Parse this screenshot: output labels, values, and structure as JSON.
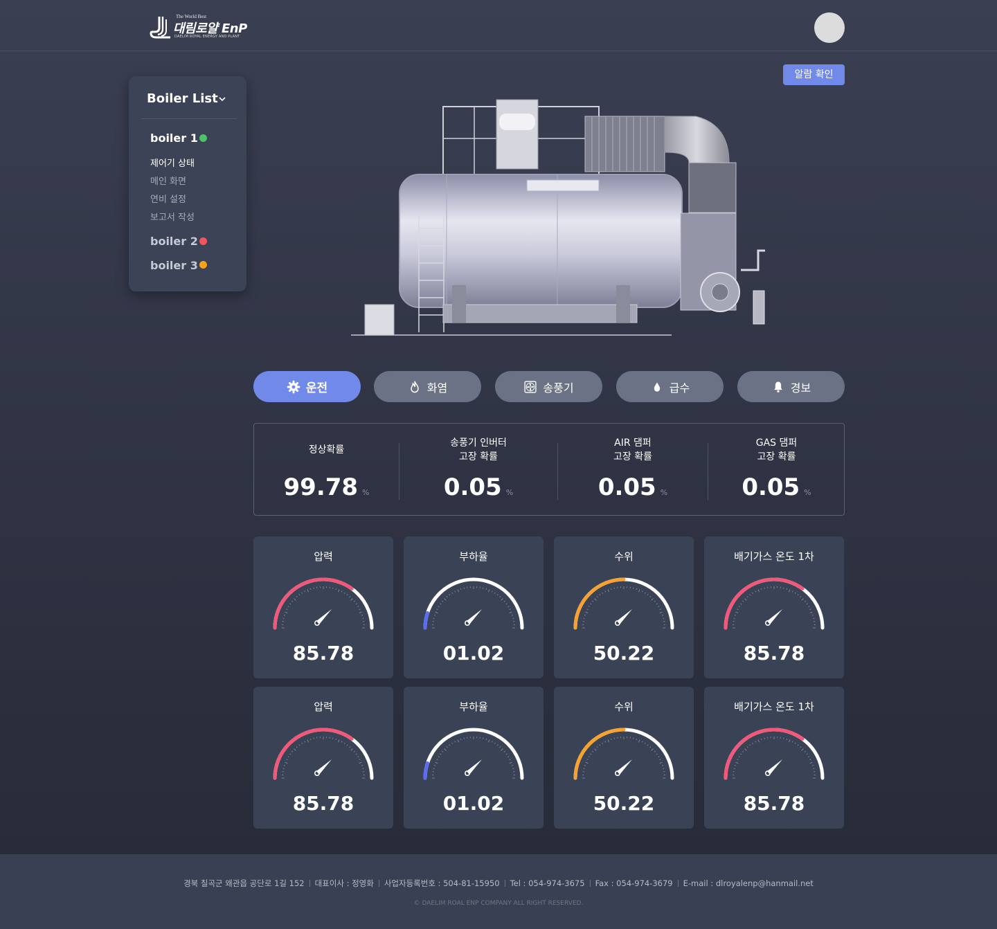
{
  "header": {
    "logo_top": "The World Best",
    "logo_main": "대림로얄 EnP",
    "logo_sub": "DAELIM ROYAL ENERGY AND PLANT"
  },
  "alarm_button": "알람 확인",
  "sidebar": {
    "title": "Boiler List",
    "boilers": [
      {
        "label": "boiler 1",
        "status_color": "#4fc265",
        "submenu": [
          "제어기 상태",
          "메인 화면",
          "연비 설정",
          "보고서 작성"
        ]
      },
      {
        "label": "boiler 2",
        "status_color": "#f05561"
      },
      {
        "label": "boiler 3",
        "status_color": "#f7a21c"
      }
    ]
  },
  "tabs": [
    {
      "label": "운전",
      "icon": "gear-icon",
      "active": true
    },
    {
      "label": "화염",
      "icon": "flame-icon",
      "active": false
    },
    {
      "label": "송풍기",
      "icon": "fan-icon",
      "active": false
    },
    {
      "label": "급수",
      "icon": "water-drop-icon",
      "active": false
    },
    {
      "label": "경보",
      "icon": "bell-icon",
      "active": false
    }
  ],
  "probabilities": [
    {
      "label_line1": "정상확률",
      "label_line2": "",
      "value": "99.78",
      "unit": "%"
    },
    {
      "label_line1": "송풍기 인버터",
      "label_line2": "고장 확률",
      "value": "0.05",
      "unit": "%"
    },
    {
      "label_line1": "AIR 댐퍼",
      "label_line2": "고장 확률",
      "value": "0.05",
      "unit": "%"
    },
    {
      "label_line1": "GAS 댐퍼",
      "label_line2": "고장 확률",
      "value": "0.05",
      "unit": "%"
    }
  ],
  "gauges": [
    {
      "title": "압력",
      "value": "85.78",
      "fill": 0.7,
      "color": "#f2587a"
    },
    {
      "title": "부하율",
      "value": "01.02",
      "fill": 0.1,
      "color": "#5a6cf0"
    },
    {
      "title": "수위",
      "value": "50.22",
      "fill": 0.5,
      "color": "#f7a230"
    },
    {
      "title": "배기가스 온도 1차",
      "value": "85.78",
      "fill": 0.7,
      "color": "#f2587a"
    },
    {
      "title": "압력",
      "value": "85.78",
      "fill": 0.7,
      "color": "#f2587a"
    },
    {
      "title": "부하율",
      "value": "01.02",
      "fill": 0.1,
      "color": "#5a6cf0"
    },
    {
      "title": "수위",
      "value": "50.22",
      "fill": 0.5,
      "color": "#f7a230"
    },
    {
      "title": "배기가스 온도 1차",
      "value": "85.78",
      "fill": 0.7,
      "color": "#f2587a"
    }
  ],
  "footer": {
    "info": [
      "경북 칠곡군 왜관읍 공단로 1길 152",
      "대표이사 : 정영화",
      "사업자등록번호 : 504-81-15950",
      "Tel : 054-974-3675",
      "Fax : 054-974-3679",
      "E-mail : dlroyalenp@hanmail.net"
    ],
    "copyright": "© DAELIM ROAL ENP COMPANY ALL RIGHT RESERVED."
  }
}
